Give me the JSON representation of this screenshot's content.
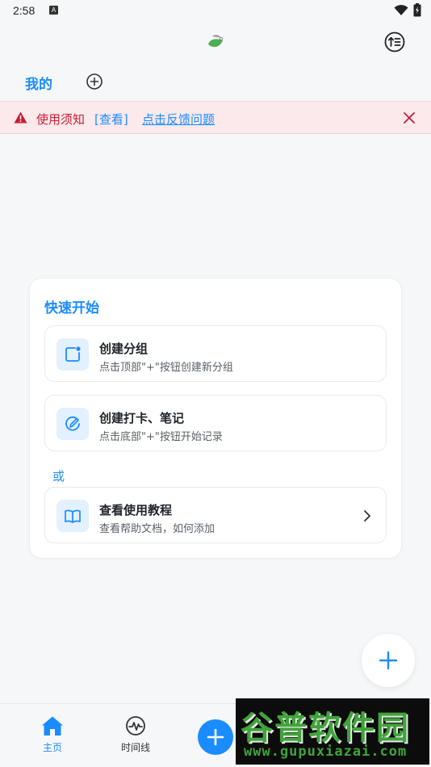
{
  "status_bar": {
    "time": "2:58",
    "indicator": "A",
    "icons": [
      "wifi-icon",
      "battery-icon"
    ]
  },
  "header": {
    "logo": "app-logo",
    "sort_icon": "sort-icon"
  },
  "tabs": {
    "mine_label": "我的",
    "add_icon": "add-circle-icon"
  },
  "notice": {
    "text": "使用须知",
    "view_label": "[查看]",
    "feedback_label": "点击反馈问题",
    "warning_color": "#c81e34"
  },
  "quick_start": {
    "title": "快速开始",
    "items": [
      {
        "title": "创建分组",
        "subtitle": "点击顶部\"+\"按钮创建新分组",
        "icon": "new-group-icon"
      },
      {
        "title": "创建打卡、笔记",
        "subtitle": "点击底部\"+\"按钮开始记录",
        "icon": "edit-circle-icon"
      }
    ],
    "or_label": "或",
    "tutorial": {
      "title": "查看使用教程",
      "subtitle": "查看帮助文档，如何添加",
      "icon": "book-icon"
    }
  },
  "bottom_nav": {
    "home_label": "主页",
    "timeline_label": "时间线",
    "accent_color": "#1a8cff"
  },
  "watermark": {
    "main": "谷普软件园",
    "url": "www.gupuxiazai.com"
  }
}
